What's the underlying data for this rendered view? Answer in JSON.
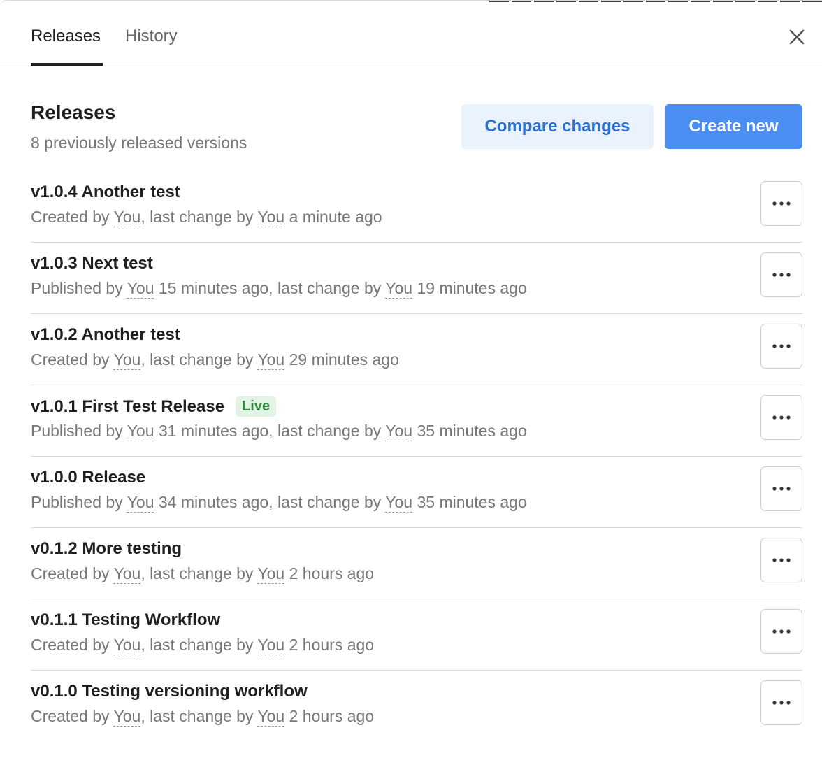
{
  "tabs": [
    {
      "label": "Releases",
      "active": true
    },
    {
      "label": "History",
      "active": false
    }
  ],
  "close_icon": "close-icon",
  "header": {
    "title": "Releases",
    "subtitle": "8 previously released versions",
    "compare_label": "Compare changes",
    "create_label": "Create new"
  },
  "colors": {
    "accent": "#4b8ef1",
    "accent_light": "#eaf3fd",
    "live_text": "#2f8a3e",
    "live_bg": "#e3f3e6"
  },
  "releases": [
    {
      "title": "v1.0.4 Another test",
      "live": false,
      "action": "Created by",
      "user1": "You",
      "mid": "last change by",
      "user2": "You",
      "time2": "a minute ago"
    },
    {
      "title": "v1.0.3 Next test",
      "live": false,
      "action": "Published by",
      "user1": "You",
      "time1": "15 minutes ago",
      "mid": "last change by",
      "user2": "You",
      "time2": "19 minutes ago"
    },
    {
      "title": "v1.0.2 Another test",
      "live": false,
      "action": "Created by",
      "user1": "You",
      "mid": "last change by",
      "user2": "You",
      "time2": "29 minutes ago"
    },
    {
      "title": "v1.0.1 First Test Release",
      "live": true,
      "badge": "Live",
      "action": "Published by",
      "user1": "You",
      "time1": "31 minutes ago",
      "mid": "last change by",
      "user2": "You",
      "time2": "35 minutes ago"
    },
    {
      "title": "v1.0.0 Release",
      "live": false,
      "action": "Published by",
      "user1": "You",
      "time1": "34 minutes ago",
      "mid": "last change by",
      "user2": "You",
      "time2": "35 minutes ago"
    },
    {
      "title": "v0.1.2 More testing",
      "live": false,
      "action": "Created by",
      "user1": "You",
      "mid": "last change by",
      "user2": "You",
      "time2": "2 hours ago"
    },
    {
      "title": "v0.1.1 Testing Workflow",
      "live": false,
      "action": "Created by",
      "user1": "You",
      "mid": "last change by",
      "user2": "You",
      "time2": "2 hours ago"
    },
    {
      "title": "v0.1.0 Testing versioning workflow",
      "live": false,
      "action": "Created by",
      "user1": "You",
      "mid": "last change by",
      "user2": "You",
      "time2": "2 hours ago"
    }
  ],
  "more_icon": "more-horizontal-icon"
}
